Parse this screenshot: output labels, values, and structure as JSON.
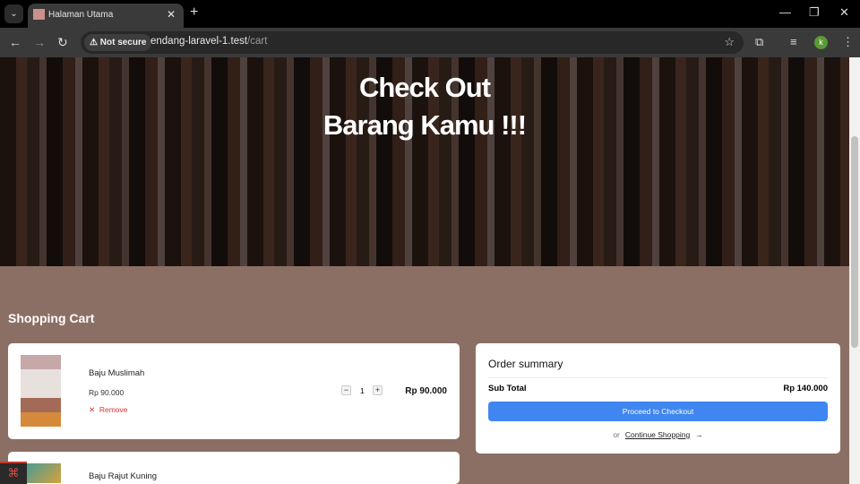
{
  "browser": {
    "tab_title": "Halaman Utama",
    "not_secure": "Not secure",
    "url_host": "endang-laravel-1.test",
    "url_path": "/cart",
    "avatar": "k"
  },
  "hero": {
    "line1": "Check Out",
    "line2": "Barang Kamu !!!"
  },
  "cart": {
    "title": "Shopping Cart",
    "items": [
      {
        "name": "Baju Muslimah",
        "price": "Rp 90.000",
        "qty": "1",
        "total": "Rp 90.000",
        "remove": "Remove"
      },
      {
        "name": "Baju Rajut Kuning"
      }
    ]
  },
  "summary": {
    "title": "Order summary",
    "subtotal_label": "Sub Total",
    "subtotal": "Rp 140.000",
    "checkout": "Proceed to Checkout",
    "or": "or",
    "continue": "Continue Shopping"
  },
  "colors": {
    "accent": "#3f86f0",
    "bg": "#8c6f64",
    "remove": "#d43a3a"
  }
}
